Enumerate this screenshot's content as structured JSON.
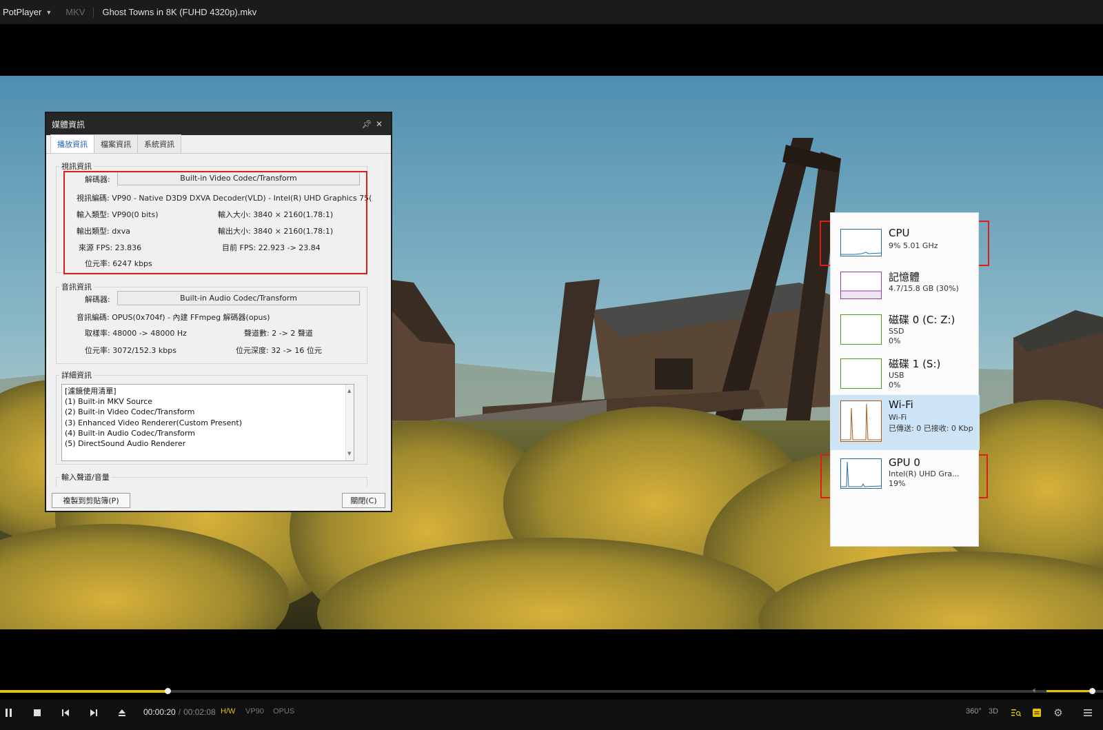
{
  "titlebar": {
    "app_name": "PotPlayer",
    "format": "MKV",
    "title": "Ghost Towns in 8K (FUHD 4320p).mkv"
  },
  "media_info": {
    "window_title": "媒體資訊",
    "tabs": [
      "播放資訊",
      "檔案資訊",
      "系統資訊"
    ],
    "video": {
      "section_label": "視訊資訊",
      "decoder_label": "解碼器:",
      "decoder_value": "Built-in Video Codec/Transform",
      "codec_line": "視訊編碼: VP90 - Native D3D9 DXVA Decoder(VLD) - Intel(R) UHD Graphics 75(",
      "input_type": "輸入類型: VP90(0 bits)",
      "input_size": "輸入大小: 3840 × 2160(1.78:1)",
      "output_type": "輸出類型: dxva",
      "output_size": "輸出大小: 3840 × 2160(1.78:1)",
      "source_fps": "來源 FPS: 23.836",
      "current_fps": "目前 FPS: 22.923 -> 23.84",
      "bitrate": "位元率: 6247 kbps"
    },
    "audio": {
      "section_label": "音訊資訊",
      "decoder_label": "解碼器:",
      "decoder_value": "Built-in Audio Codec/Transform",
      "codec_line": "音訊編碼: OPUS(0x704f) - 內建 FFmpeg 解碼器(opus)",
      "sample_rate": "取樣率: 48000 -> 48000 Hz",
      "channels": "聲道數: 2 -> 2 聲道",
      "bitrate": "位元率: 3072/152.3 kbps",
      "bit_depth": "位元深度: 32 -> 16 位元"
    },
    "details": {
      "section_label": "詳細資訊",
      "lines": [
        "[濾鏡使用清單]",
        "  (1) Built-in MKV Source",
        "  (2) Built-in Video Codec/Transform",
        "  (3) Enhanced Video Renderer(Custom Present)",
        "  (4) Built-in Audio Codec/Transform",
        "  (5) DirectSound Audio Renderer"
      ]
    },
    "input_channel_label": "輸入聲道/音量",
    "copy_button": "複製到剪貼簿(P)",
    "close_button": "關閉(C)"
  },
  "performance": {
    "items": [
      {
        "name": "CPU",
        "sub1": "9%  5.01 GHz",
        "sub2": "",
        "sub3": "",
        "color": "#1f6ea8"
      },
      {
        "name": "記憶體",
        "sub1": "4.7/15.8 GB (30%)",
        "sub2": "",
        "sub3": "",
        "color": "#8b3ea6"
      },
      {
        "name": "磁碟 0 (C: Z:)",
        "sub1": "SSD",
        "sub2": "0%",
        "sub3": "",
        "color": "#4f9a1a"
      },
      {
        "name": "磁碟 1 (S:)",
        "sub1": "USB",
        "sub2": "0%",
        "sub3": "",
        "color": "#4f9a1a"
      },
      {
        "name": "Wi-Fi",
        "sub1": "Wi-Fi",
        "sub2": "已傳送: 0 已接收: 0 Kbp",
        "sub3": "",
        "color": "#a85a1f"
      },
      {
        "name": "GPU 0",
        "sub1": "Intel(R) UHD Gra...",
        "sub2": "19%",
        "sub3": "",
        "color": "#1f6ea8"
      }
    ]
  },
  "player": {
    "current_time": "00:00:20",
    "total_time": "00:02:08",
    "tags": [
      "H/W",
      "VP90",
      "OPUS"
    ],
    "progress": 0.152,
    "volume": 0.92,
    "right_icons": [
      "360°",
      "3D"
    ],
    "accent": "#e5c100"
  }
}
